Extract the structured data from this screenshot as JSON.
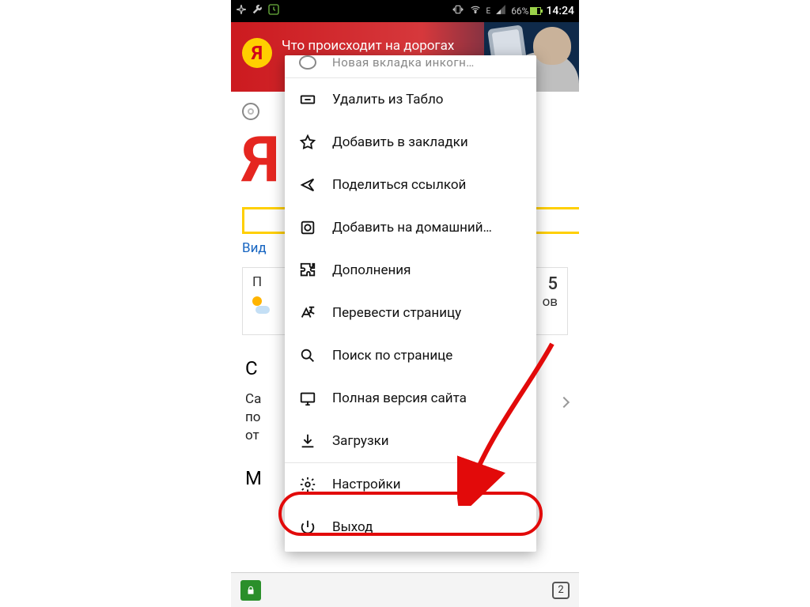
{
  "status": {
    "battery_pct": "66%",
    "clock": "14:24",
    "net_label": "E"
  },
  "banner": {
    "yandex_letter": "Я",
    "headline": "Что происходит на дорогах"
  },
  "backdrop": {
    "big_letter": "Я",
    "video_link": "Вид",
    "forecast_prefix": "П",
    "forecast_number": "5",
    "forecast_unit": "ов",
    "section_letter_1": "С",
    "article_line1": "Са",
    "article_line2": "по",
    "article_line3": "от",
    "section_letter_2": "М"
  },
  "bottom": {
    "tab_count": "2"
  },
  "menu": {
    "items": [
      {
        "id": "new-incognito",
        "icon": "circle-icon",
        "label": "Новая вкладка инкогн…",
        "truncated": true
      },
      {
        "id": "remove-tablo",
        "icon": "remove-tile-icon",
        "label": "Удалить из Табло"
      },
      {
        "id": "add-bookmark",
        "icon": "star-icon",
        "label": "Добавить в закладки"
      },
      {
        "id": "share-link",
        "icon": "share-icon",
        "label": "Поделиться ссылкой"
      },
      {
        "id": "add-homescreen",
        "icon": "homescreen-icon",
        "label": "Добавить на домашний…"
      },
      {
        "id": "addons",
        "icon": "puzzle-icon",
        "label": "Дополнения"
      },
      {
        "id": "translate",
        "icon": "translate-icon",
        "label": "Перевести страницу"
      },
      {
        "id": "find-in-page",
        "icon": "search-icon",
        "label": "Поиск по странице"
      },
      {
        "id": "desktop-site",
        "icon": "desktop-icon",
        "label": "Полная версия сайта"
      },
      {
        "id": "downloads",
        "icon": "download-icon",
        "label": "Загрузки"
      },
      {
        "id": "settings",
        "icon": "gear-icon",
        "label": "Настройки",
        "highlighted": true
      },
      {
        "id": "exit",
        "icon": "power-icon",
        "label": "Выход"
      }
    ]
  }
}
